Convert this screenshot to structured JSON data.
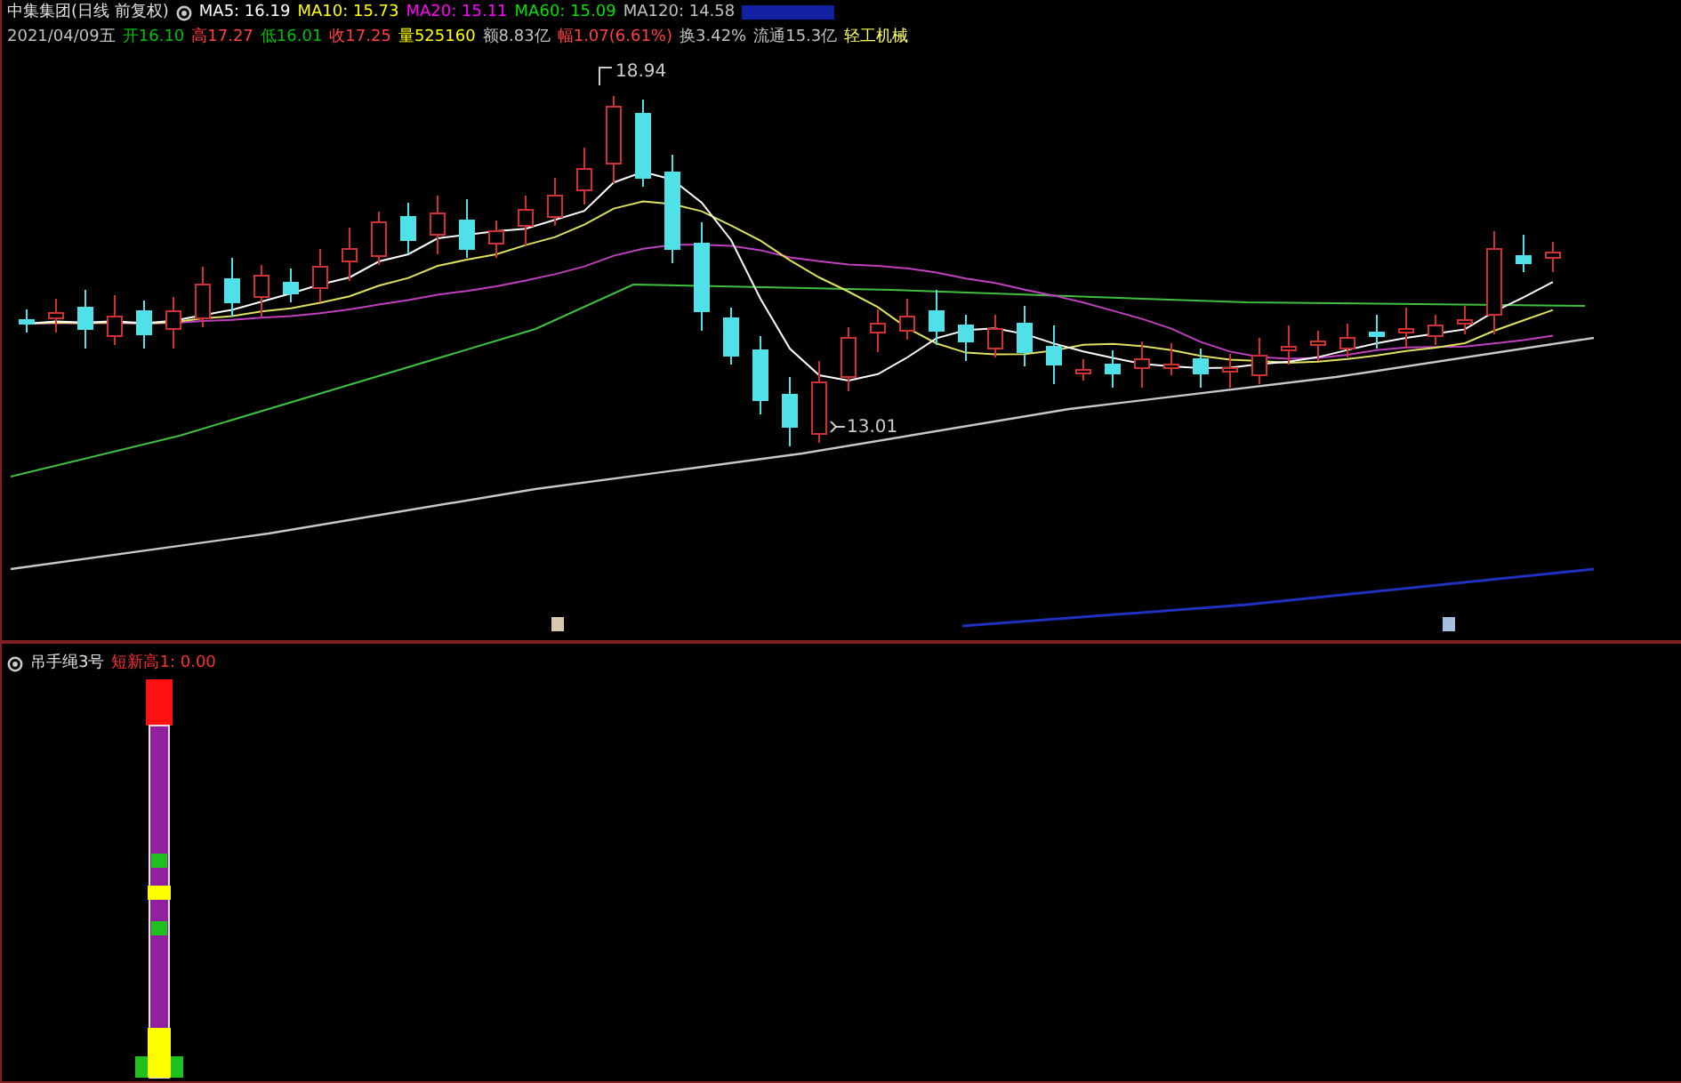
{
  "main_panel": {
    "title": "中集集团(日线 前复权)",
    "moving_averages": [
      {
        "label": "MA5: 16.19",
        "color": "#ffffff"
      },
      {
        "label": "MA10: 15.73",
        "color": "#ffff00"
      },
      {
        "label": "MA20: 15.11",
        "color": "#ff00ff"
      },
      {
        "label": "MA60: 15.09",
        "color": "#00e000"
      },
      {
        "label": "MA120: 14.58",
        "color": "#c0c0c0"
      }
    ],
    "quote": [
      {
        "label": "2021/04/09五",
        "color": "#c0c0c0"
      },
      {
        "label": "开16.10",
        "color": "#00c000"
      },
      {
        "label": "高17.27",
        "color": "#ff4040"
      },
      {
        "label": "低16.01",
        "color": "#00c000"
      },
      {
        "label": "收17.25",
        "color": "#ff4040"
      },
      {
        "label": "量525160",
        "color": "#ffff00"
      },
      {
        "label": "额8.83亿",
        "color": "#c0c0c0"
      },
      {
        "label": "幅1.07(6.61%)",
        "color": "#ff4040"
      },
      {
        "label": "换3.42%",
        "color": "#c0c0c0"
      },
      {
        "label": "流通15.3亿",
        "color": "#c0c0c0"
      },
      {
        "label": "轻工机械",
        "color": "#ffff60"
      }
    ],
    "high_label": "18.94",
    "low_label": "13.01"
  },
  "indicator_panel": {
    "name": "吊手绳3号",
    "reading": "短新高1: 0.00"
  }
}
